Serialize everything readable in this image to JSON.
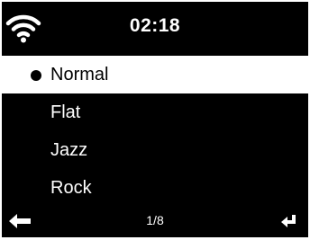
{
  "status_bar": {
    "time": "02:18",
    "wifi_icon": "wifi-signal-icon"
  },
  "menu": {
    "items": [
      {
        "label": "Normal",
        "selected": true
      },
      {
        "label": "Flat",
        "selected": false
      },
      {
        "label": "Jazz",
        "selected": false
      },
      {
        "label": "Rock",
        "selected": false
      }
    ]
  },
  "footer": {
    "page_indicator": "1/8",
    "back_icon": "back-arrow-icon",
    "enter_icon": "enter-return-icon"
  },
  "colors": {
    "background": "#000000",
    "text": "#ffffff",
    "highlight": "#ffffff",
    "highlight_text": "#000000"
  }
}
